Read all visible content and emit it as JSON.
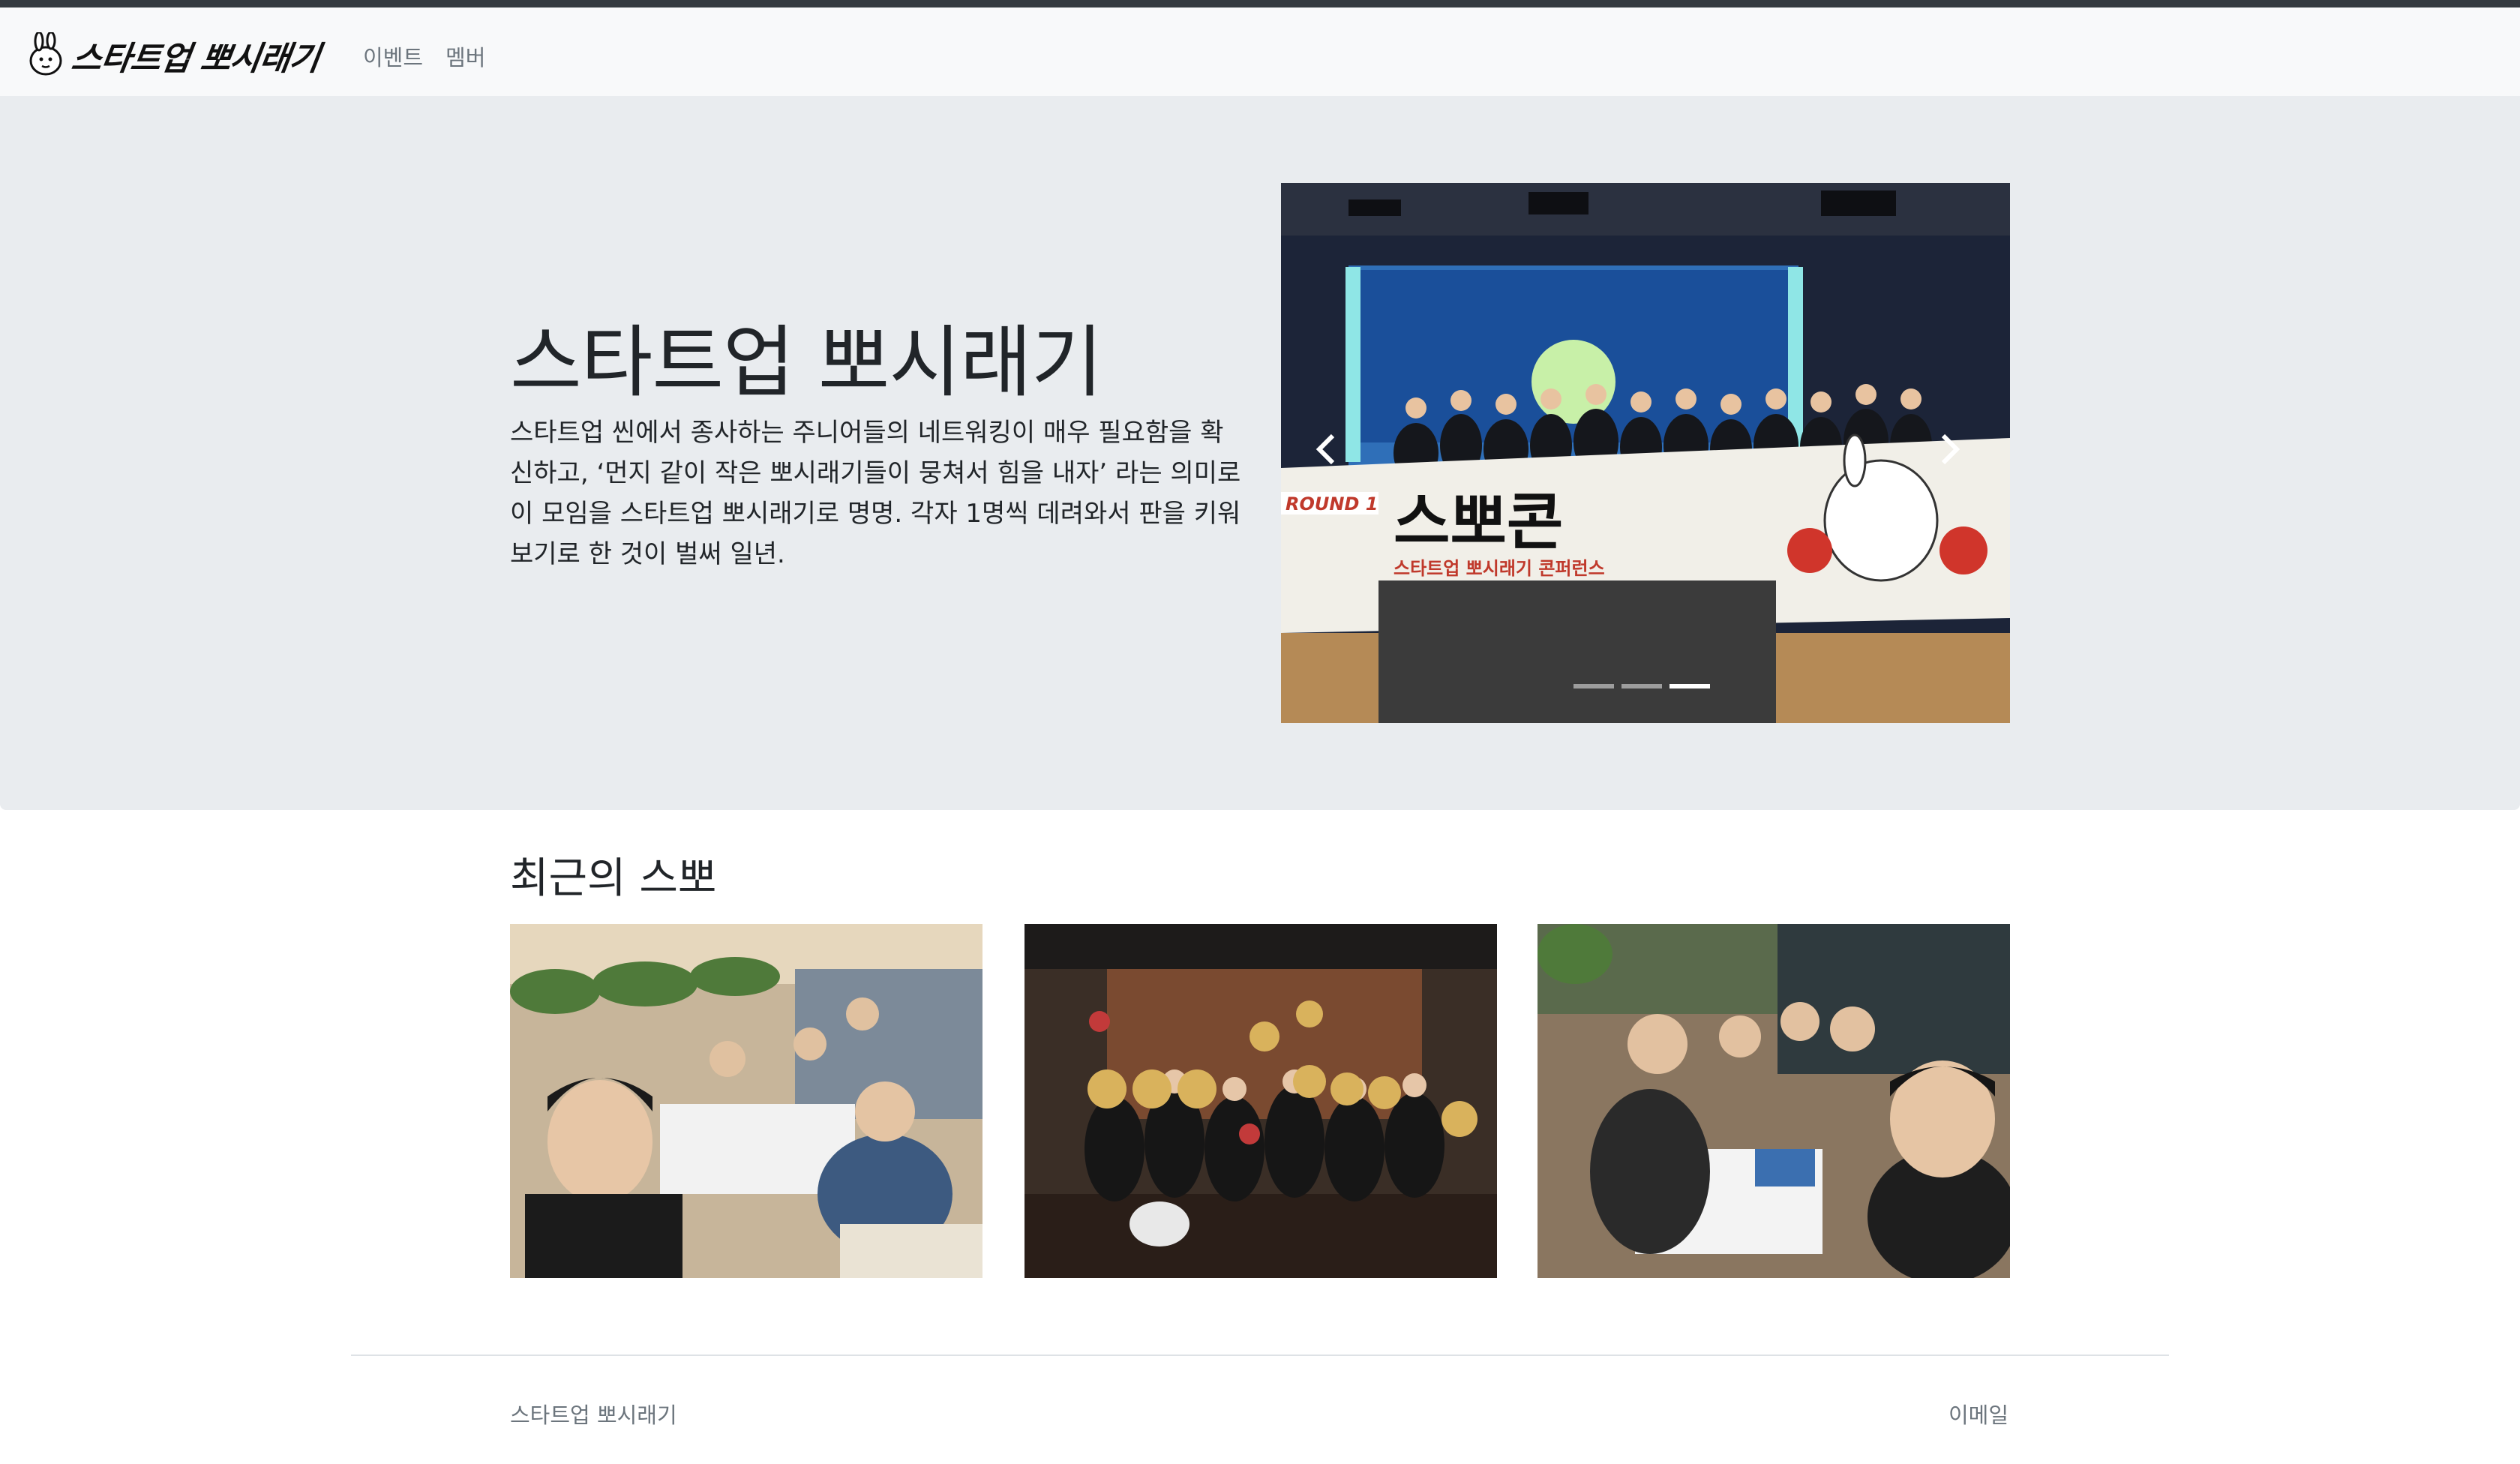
{
  "header": {
    "brand_name": "스타트업 뽀시래기",
    "logo_icon": "rabbit-mascot-icon",
    "nav": [
      {
        "label": "이벤트"
      },
      {
        "label": "멤버"
      }
    ]
  },
  "hero": {
    "title": "스타트업 뽀시래기",
    "description": "스타트업 씬에서 종사하는 주니어들의 네트워킹이 매우 필요함을 확신하고, ‘먼지 같이 작은 뽀시래기들이 뭉쳐서 힘을 내자’ 라는 의미로 이 모임을 스타트업 뽀시래기로 명명. 각자 1명씩 데려와서 판을 키워보기로 한 것이 벌써 일년.",
    "carousel": {
      "slide_count": 3,
      "active_index": 2,
      "prev_icon": "chevron-left-icon",
      "next_icon": "chevron-right-icon",
      "banner_text": "스뽀콘",
      "banner_round": "ROUND 1",
      "banner_sub": "스타트업 뽀시래기 콘퍼런스"
    }
  },
  "recent": {
    "title": "최근의 스뽀"
  },
  "footer": {
    "left": "스타트업 뽀시래기",
    "right": "이메일"
  },
  "colors": {
    "topbar": "#343a40",
    "navbar": "#f8f9fa",
    "hero_bg": "#e9ecef",
    "muted_text": "#6c757d"
  }
}
